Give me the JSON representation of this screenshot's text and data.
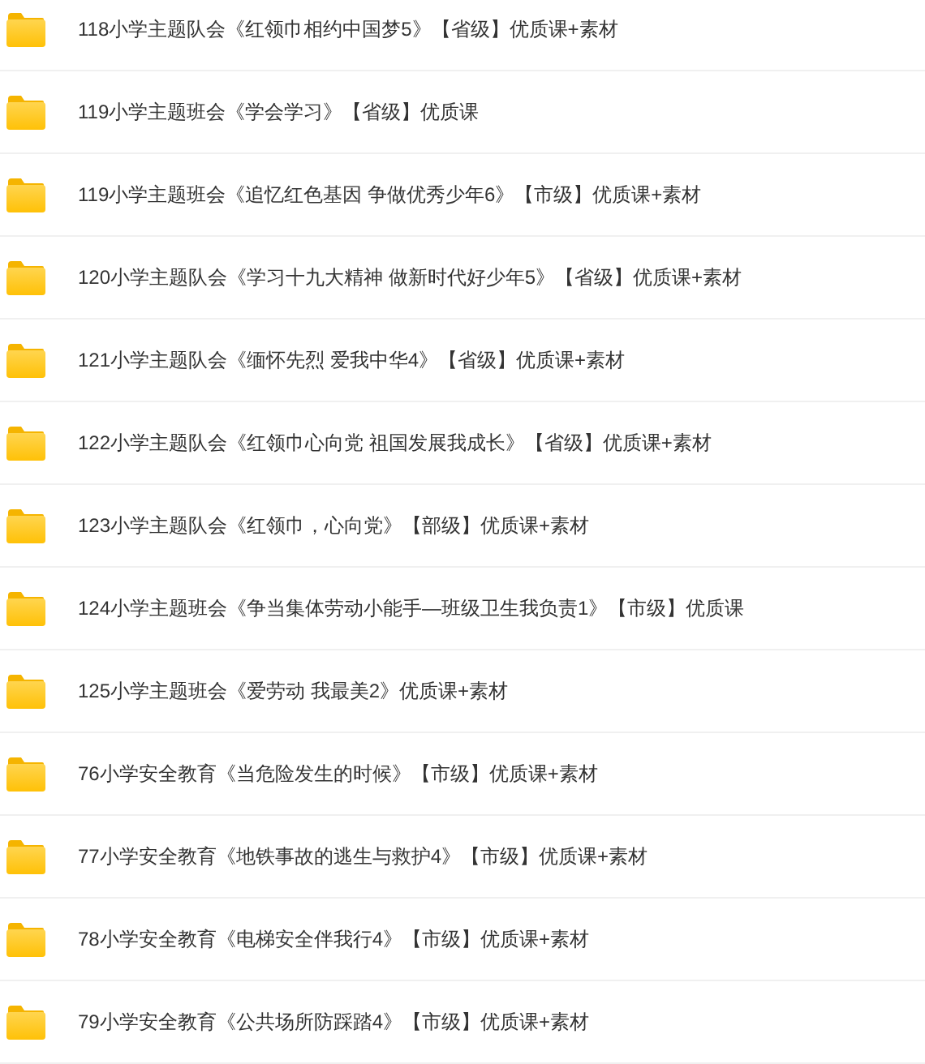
{
  "folders": [
    {
      "name": "118小学主题队会《红领巾相约中国梦5》【省级】优质课+素材"
    },
    {
      "name": "119小学主题班会《学会学习》【省级】优质课"
    },
    {
      "name": "119小学主题班会《追忆红色基因 争做优秀少年6》【市级】优质课+素材"
    },
    {
      "name": "120小学主题队会《学习十九大精神 做新时代好少年5》【省级】优质课+素材"
    },
    {
      "name": "121小学主题队会《缅怀先烈 爱我中华4》【省级】优质课+素材"
    },
    {
      "name": "122小学主题队会《红领巾心向党 祖国发展我成长》【省级】优质课+素材"
    },
    {
      "name": "123小学主题队会《红领巾，心向党》【部级】优质课+素材"
    },
    {
      "name": "124小学主题班会《争当集体劳动小能手—班级卫生我负责1》【市级】优质课"
    },
    {
      "name": "125小学主题班会《爱劳动 我最美2》优质课+素材"
    },
    {
      "name": "76小学安全教育《当危险发生的时候》【市级】优质课+素材"
    },
    {
      "name": "77小学安全教育《地铁事故的逃生与救护4》【市级】优质课+素材"
    },
    {
      "name": "78小学安全教育《电梯安全伴我行4》【市级】优质课+素材"
    },
    {
      "name": "79小学安全教育《公共场所防踩踏4》【市级】优质课+素材"
    }
  ]
}
